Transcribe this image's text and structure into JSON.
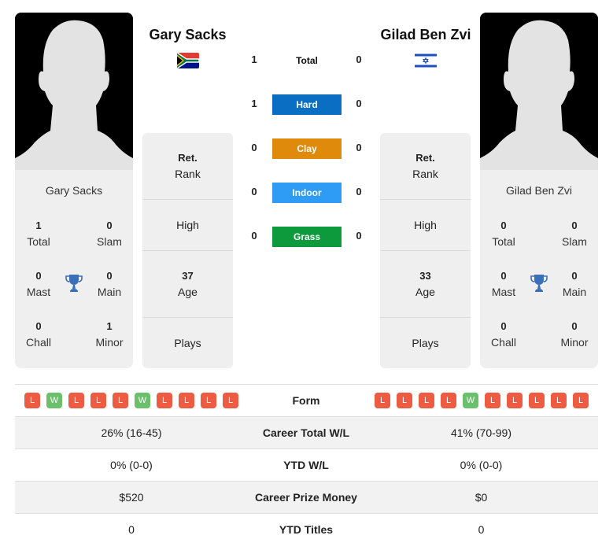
{
  "player1": {
    "name": "Gary Sacks",
    "flag": "south-africa",
    "stats": {
      "total": {
        "value": "1",
        "label": "Total"
      },
      "slam": {
        "value": "0",
        "label": "Slam"
      },
      "mast": {
        "value": "0",
        "label": "Mast"
      },
      "main": {
        "value": "0",
        "label": "Main"
      },
      "chall": {
        "value": "0",
        "label": "Chall"
      },
      "minor": {
        "value": "1",
        "label": "Minor"
      }
    },
    "rank": {
      "value": "Ret.",
      "label": "Rank"
    },
    "high": {
      "label": "High"
    },
    "age": {
      "value": "37",
      "label": "Age"
    },
    "plays": {
      "label": "Plays"
    },
    "form": [
      "L",
      "W",
      "L",
      "L",
      "L",
      "W",
      "L",
      "L",
      "L",
      "L"
    ]
  },
  "player2": {
    "name": "Gilad Ben Zvi",
    "flag": "israel",
    "stats": {
      "total": {
        "value": "0",
        "label": "Total"
      },
      "slam": {
        "value": "0",
        "label": "Slam"
      },
      "mast": {
        "value": "0",
        "label": "Mast"
      },
      "main": {
        "value": "0",
        "label": "Main"
      },
      "chall": {
        "value": "0",
        "label": "Chall"
      },
      "minor": {
        "value": "0",
        "label": "Minor"
      }
    },
    "rank": {
      "value": "Ret.",
      "label": "Rank"
    },
    "high": {
      "label": "High"
    },
    "age": {
      "value": "33",
      "label": "Age"
    },
    "plays": {
      "label": "Plays"
    },
    "form": [
      "L",
      "L",
      "L",
      "L",
      "W",
      "L",
      "L",
      "L",
      "L",
      "L"
    ]
  },
  "surfaces": [
    {
      "label": "Total",
      "p1": "1",
      "p2": "0",
      "color": ""
    },
    {
      "label": "Hard",
      "p1": "1",
      "p2": "0",
      "color": "#0a6fc2"
    },
    {
      "label": "Clay",
      "p1": "0",
      "p2": "0",
      "color": "#e08a0b"
    },
    {
      "label": "Indoor",
      "p1": "0",
      "p2": "0",
      "color": "#2e9cf5"
    },
    {
      "label": "Grass",
      "p1": "0",
      "p2": "0",
      "color": "#0d9a3d"
    }
  ],
  "table": {
    "form_label": "Form",
    "rows": [
      {
        "label": "Career Total W/L",
        "p1": "26% (16-45)",
        "p2": "41% (70-99)"
      },
      {
        "label": "YTD W/L",
        "p1": "0% (0-0)",
        "p2": "0% (0-0)"
      },
      {
        "label": "Career Prize Money",
        "p1": "$520",
        "p2": "$0"
      },
      {
        "label": "YTD Titles",
        "p1": "0",
        "p2": "0"
      }
    ]
  },
  "icons": {
    "trophy": "trophy-icon",
    "avatar": "silhouette-avatar"
  },
  "colors": {
    "win": "#6cbf6d",
    "loss": "#ed5b42",
    "trophy": "#3a6fba"
  }
}
